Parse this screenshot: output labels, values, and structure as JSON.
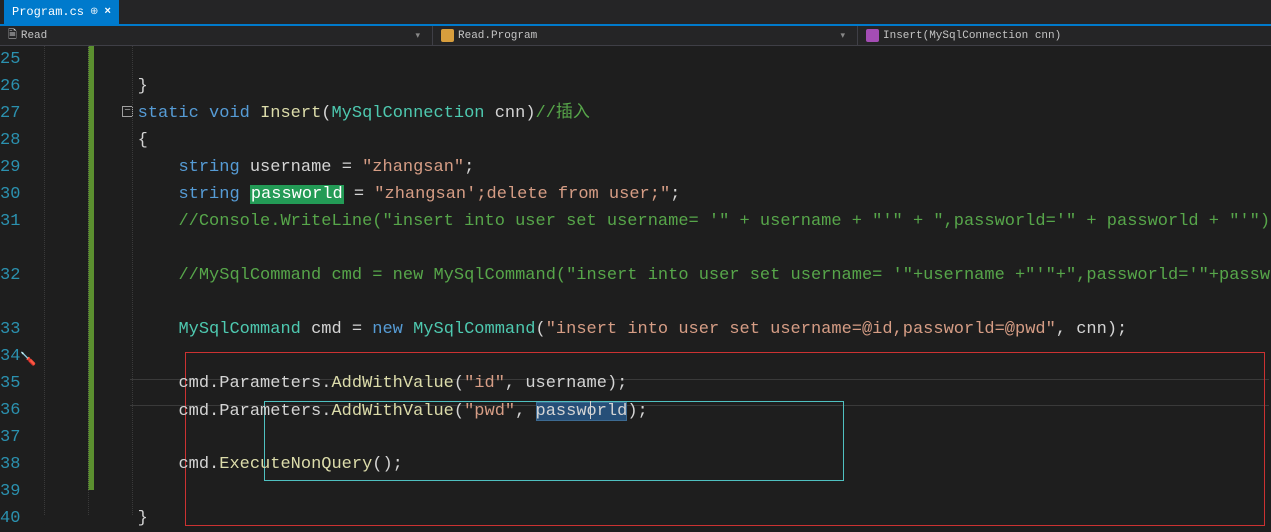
{
  "tab": {
    "filename": "Program.cs",
    "pin": "⊕",
    "close": "×"
  },
  "nav": {
    "scope": "Read",
    "class": "Read.Program",
    "method": "Insert(MySqlConnection cnn)"
  },
  "lines": {
    "start": 25,
    "end": 40
  },
  "code": {
    "l26_brace": "}",
    "l27_kw_static": "static",
    "l27_kw_void": "void",
    "l27_fn": "Insert",
    "l27_type": "MySqlConnection",
    "l27_param": "cnn",
    "l27_cmt": "//插入",
    "l28_brace": "{",
    "l29_kw": "string",
    "l29_var": "username",
    "l29_str": "\"zhangsan\"",
    "l30_kw": "string",
    "l30_var": "passworld",
    "l30_str": "\"zhangsan';delete from user;\"",
    "l31_cmt": "//Console.WriteLine(\"insert into user set username= '\" + username + \"'\" + \",passworld='\" + passworld + \"'\");",
    "l32_cmt": "//MySqlCommand cmd = new MySqlCommand(\"insert into user set username= '\"+username +\"'\"+\",passworld='\"+passworld+\"'\",cnn);",
    "l33_type": "MySqlCommand",
    "l33_var": "cmd",
    "l33_kw_new": "new",
    "l33_type2": "MySqlCommand",
    "l33_str": "\"insert into user set username=@id,passworld=@pwd\"",
    "l33_arg2": "cnn",
    "l35_head": "cmd.Parameters.",
    "l35_fn": "AddWithValue",
    "l35_str": "\"id\"",
    "l35_arg": "username",
    "l36_head": "cmd.Parameters.",
    "l36_fn": "AddWithValue",
    "l36_str": "\"pwd\"",
    "l36_arg": "passworld",
    "l38_head": "cmd.",
    "l38_fn": "ExecuteNonQuery",
    "l40_brace": "}"
  }
}
